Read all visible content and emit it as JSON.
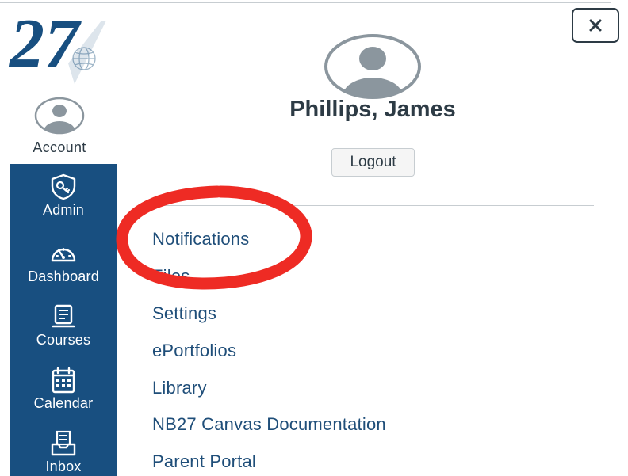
{
  "logo": {
    "text": "27"
  },
  "nav": {
    "account": {
      "label": "Account",
      "icon": "user-avatar-icon"
    },
    "items": [
      {
        "label": "Admin",
        "icon": "shield-key-icon"
      },
      {
        "label": "Dashboard",
        "icon": "speedometer-icon"
      },
      {
        "label": "Courses",
        "icon": "book-icon"
      },
      {
        "label": "Calendar",
        "icon": "calendar-icon"
      },
      {
        "label": "Inbox",
        "icon": "inbox-icon"
      }
    ],
    "background_color": "#184f80"
  },
  "tray": {
    "close_icon": "close-icon",
    "user_name": "Phillips, James",
    "logout_label": "Logout",
    "links": [
      {
        "label": "Notifications"
      },
      {
        "label": "Files"
      },
      {
        "label": "Settings"
      },
      {
        "label": "ePortfolios"
      },
      {
        "label": "Library"
      },
      {
        "label": "NB27 Canvas Documentation"
      },
      {
        "label": "Parent Portal"
      }
    ],
    "link_color": "#1f4e79"
  },
  "annotation": {
    "color": "#ee2b24"
  }
}
